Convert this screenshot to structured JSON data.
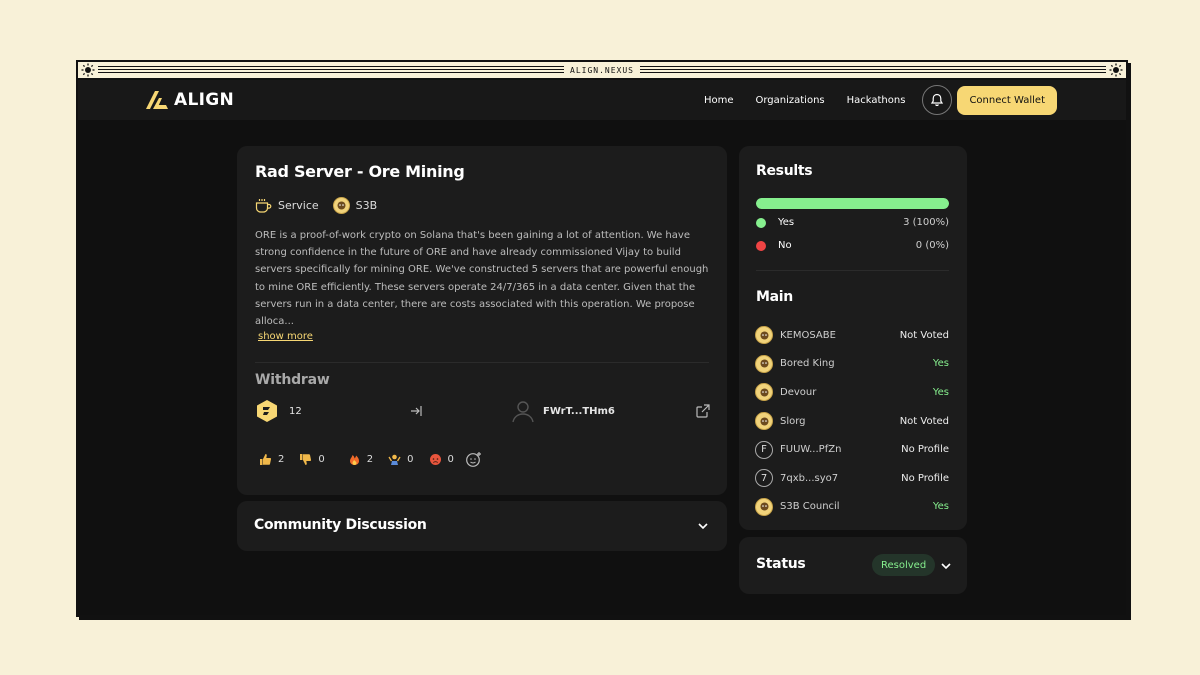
{
  "window": {
    "title": "ALIGN.NEXUS"
  },
  "nav": {
    "logo_text": "ALIGN",
    "links": [
      "Home",
      "Organizations",
      "Hackathons"
    ],
    "connect_label": "Connect Wallet",
    "accent": "#f7d774"
  },
  "proposal": {
    "title": "Rad Server - Ore Mining",
    "category": "Service",
    "org": "S3B",
    "description": "ORE is a proof-of-work crypto on Solana that's been gaining a lot of attention. We have strong confidence in the future of ORE and have already commissioned Vijay to build servers specifically for mining ORE. We've constructed 5 servers that are powerful enough to mine ORE efficiently. These servers operate 24/7/365 in a data center. Given that the servers run in a data center, there are costs associated with this operation. We propose alloca...",
    "show_more": "show more",
    "withdraw": {
      "heading": "Withdraw",
      "amount": "12",
      "recipient": "FWrT...THm6"
    },
    "reactions": [
      {
        "icon": "thumbs-up-icon",
        "count": "2"
      },
      {
        "icon": "thumbs-down-icon",
        "count": "0"
      },
      {
        "icon": "fire-icon",
        "count": "2"
      },
      {
        "icon": "shrug-icon",
        "count": "0"
      },
      {
        "icon": "angry-face-icon",
        "count": "0"
      }
    ]
  },
  "community": {
    "title": "Community Discussion"
  },
  "results": {
    "heading": "Results",
    "yes_fraction": 1.0,
    "yes_label": "Yes",
    "yes_value": "3 (100%)",
    "no_label": "No",
    "no_value": "0 (0%)",
    "yes_color": "#86ef8e",
    "no_color": "#ef4444"
  },
  "main": {
    "heading": "Main",
    "members": [
      {
        "name": "KEMOSABE",
        "status": "Not Voted",
        "avatar": "gold"
      },
      {
        "name": "Bored King",
        "status": "Yes",
        "avatar": "gold"
      },
      {
        "name": "Devour",
        "status": "Yes",
        "avatar": "gold"
      },
      {
        "name": "Slorg",
        "status": "Not Voted",
        "avatar": "gold"
      },
      {
        "name": "FUUW...PfZn",
        "status": "No Profile",
        "avatar": "letter",
        "letter": "F"
      },
      {
        "name": "7qxb...syo7",
        "status": "No Profile",
        "avatar": "letter",
        "letter": "7"
      },
      {
        "name": "S3B Council",
        "status": "Yes",
        "avatar": "gold"
      }
    ]
  },
  "status": {
    "heading": "Status",
    "badge": "Resolved"
  }
}
